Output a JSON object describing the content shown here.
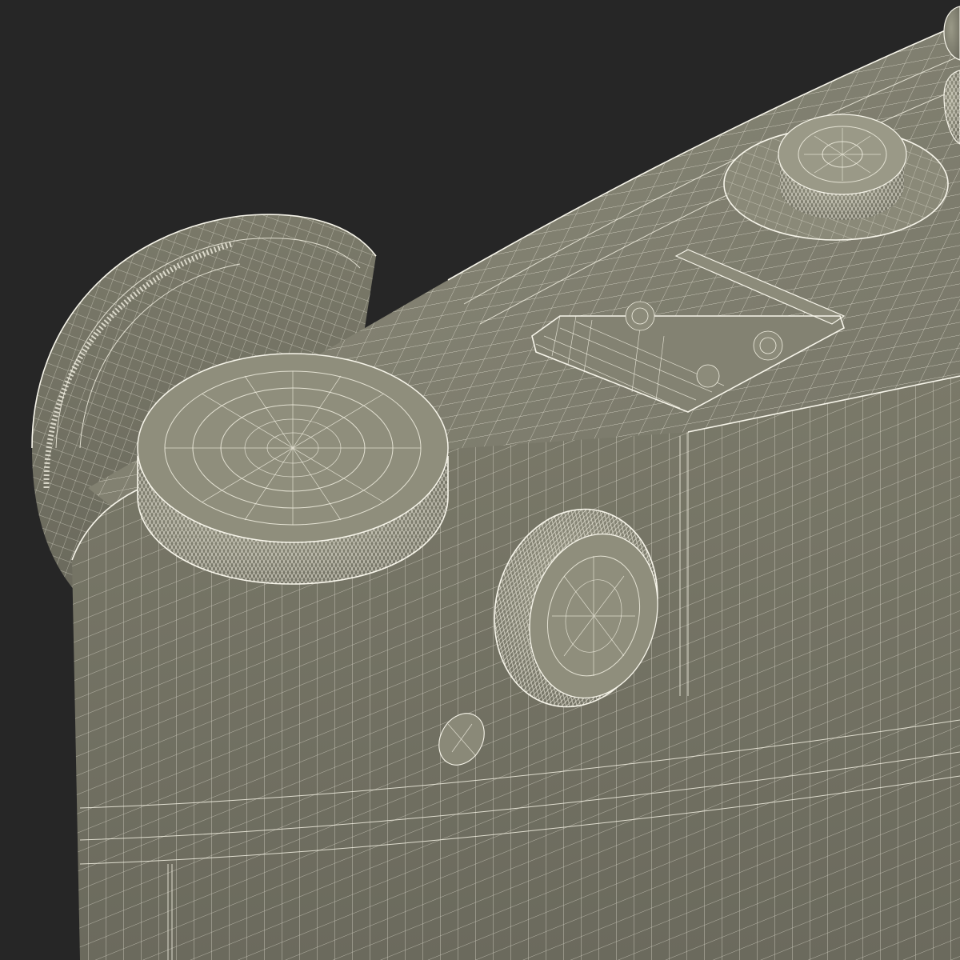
{
  "scene": {
    "subject": "camera-body-wireframe",
    "colors": {
      "background": "#262626",
      "surface": "#777668",
      "surface_light": "#8a8978",
      "surface_dark": "#5f5e53",
      "wire": "#f2f0e2"
    },
    "parts": [
      "lens-ring",
      "body-top",
      "body-front",
      "rewind-knob",
      "side-knob",
      "accessory-shoe",
      "shutter-dial",
      "screw"
    ]
  }
}
